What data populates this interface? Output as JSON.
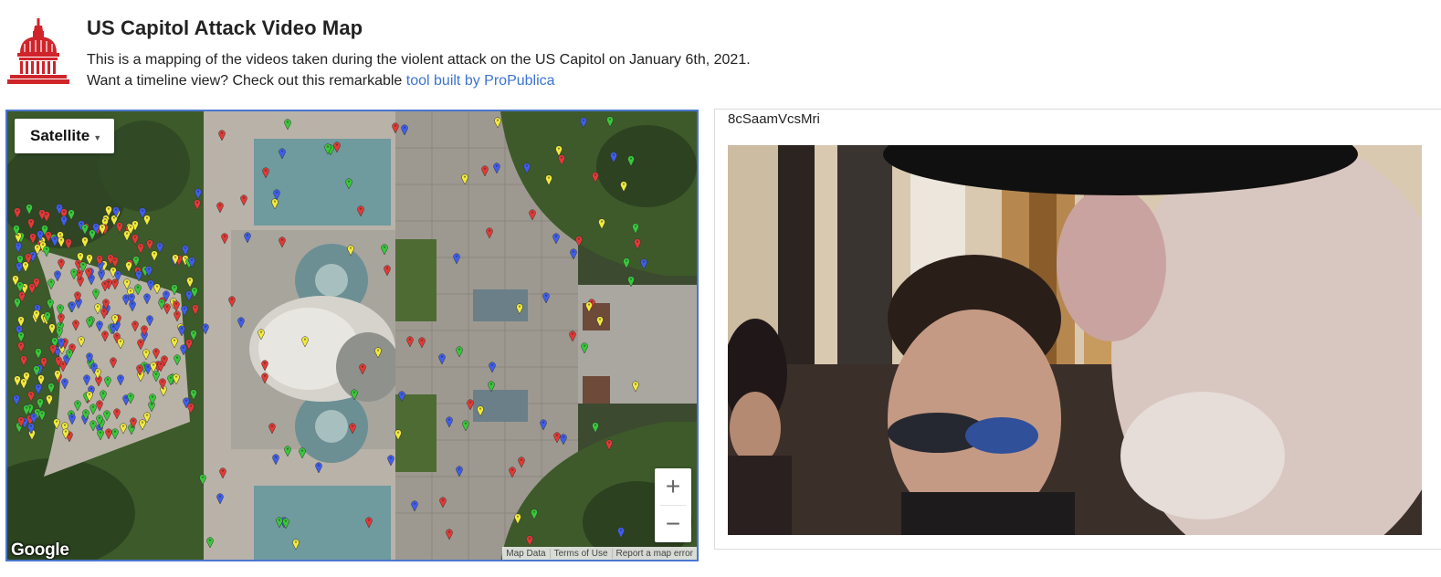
{
  "header": {
    "title": "US Capitol Attack Video Map",
    "description": "This is a mapping of the videos taken during the violent attack on the US Capitol on January 6th, 2021.",
    "timeline_prompt": "Want a timeline view? Check out this remarkable ",
    "timeline_link": "tool built by ProPublica"
  },
  "map": {
    "map_type": "Satellite",
    "zoom_in": "+",
    "zoom_out": "−",
    "google": "Google",
    "attribution": [
      "Map Data",
      "Terms of Use",
      "Report a map error"
    ],
    "marker_colors": {
      "red": "#e53935",
      "yellow": "#f2ea3c",
      "green": "#38c93a",
      "blue": "#3f5ef0"
    }
  },
  "video": {
    "id": "8cSaamVcsMri"
  },
  "colors": {
    "link": "#3b73d6",
    "map_border": "#4a76cf",
    "logo_red": "#d0242b"
  }
}
